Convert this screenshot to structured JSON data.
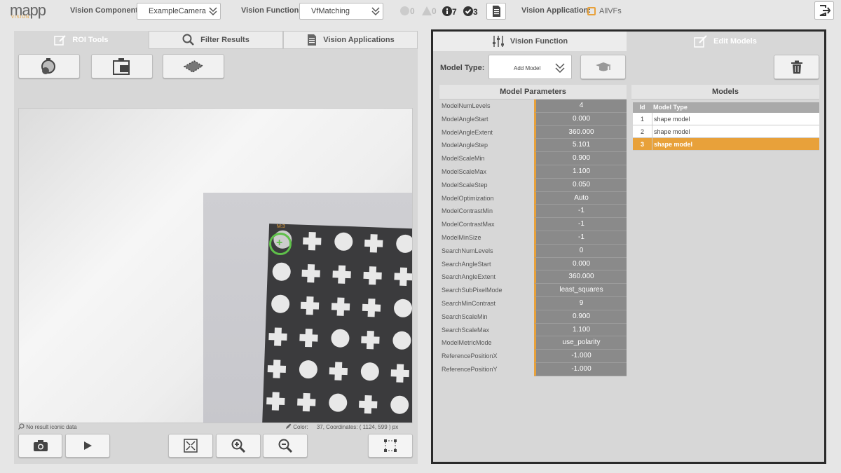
{
  "header": {
    "logo_text": "mapp",
    "logo_sub": "VISION",
    "vision_component_label": "Vision Component:",
    "vision_component_value": "ExampleCamera",
    "vision_function_label": "Vision Function:",
    "vision_function_value": "VfMatching",
    "status": {
      "errors": "0",
      "warnings": "0",
      "info": "7",
      "ok": "3"
    },
    "vision_application_label": "Vision Application:",
    "vision_application_value": "AllVFs"
  },
  "left_tabs": [
    {
      "label": "ROI Tools",
      "icon": "edit-icon",
      "active": true
    },
    {
      "label": "Filter Results",
      "icon": "search-icon",
      "active": false
    },
    {
      "label": "Vision Applications",
      "icon": "document-icon",
      "active": false
    }
  ],
  "image_panel": {
    "overlay_label": "M:3",
    "no_result_text": "No result iconic data",
    "color_label": "Color:",
    "color_value": "37",
    "coordinates_label": "Coordinates:",
    "coord_x": "1124",
    "coord_y": "599",
    "coord_unit": ") px"
  },
  "right_tabs": [
    {
      "label": "Vision Function",
      "icon": "sliders-icon",
      "active": false
    },
    {
      "label": "Edit Models",
      "icon": "edit-icon",
      "active": true
    }
  ],
  "model_type": {
    "label": "Model Type:",
    "value": "Add Model"
  },
  "params": {
    "title": "Model Parameters",
    "rows": [
      {
        "name": "ModelNumLevels",
        "value": "4"
      },
      {
        "name": "ModelAngleStart",
        "value": "0.000"
      },
      {
        "name": "ModelAngleExtent",
        "value": "360.000"
      },
      {
        "name": "ModelAngleStep",
        "value": "5.101"
      },
      {
        "name": "ModelScaleMin",
        "value": "0.900"
      },
      {
        "name": "ModelScaleMax",
        "value": "1.100"
      },
      {
        "name": "ModelScaleStep",
        "value": "0.050"
      },
      {
        "name": "ModelOptimization",
        "value": "Auto"
      },
      {
        "name": "ModelContrastMin",
        "value": "-1"
      },
      {
        "name": "ModelContrastMax",
        "value": "-1"
      },
      {
        "name": "ModelMinSize",
        "value": "-1"
      },
      {
        "name": "SearchNumLevels",
        "value": "0"
      },
      {
        "name": "SearchAngleStart",
        "value": "0.000"
      },
      {
        "name": "SearchAngleExtent",
        "value": "360.000"
      },
      {
        "name": "SearchSubPixelMode",
        "value": "least_squares"
      },
      {
        "name": "SearchMinContrast",
        "value": "9"
      },
      {
        "name": "SearchScaleMin",
        "value": "0.900"
      },
      {
        "name": "SearchScaleMax",
        "value": "1.100"
      },
      {
        "name": "ModelMetricMode",
        "value": "use_polarity"
      },
      {
        "name": "ReferencePositionX",
        "value": "-1.000"
      },
      {
        "name": "ReferencePositionY",
        "value": "-1.000"
      }
    ]
  },
  "models": {
    "title": "Models",
    "col_id": "Id",
    "col_type": "Model Type",
    "rows": [
      {
        "id": "1",
        "type": "shape model",
        "selected": false
      },
      {
        "id": "2",
        "type": "shape model",
        "selected": false
      },
      {
        "id": "3",
        "type": "shape model",
        "selected": true
      }
    ]
  },
  "colors": {
    "accent": "#e8a13a",
    "panel": "#d7d7d7",
    "value_bg": "#8a8a8a"
  }
}
